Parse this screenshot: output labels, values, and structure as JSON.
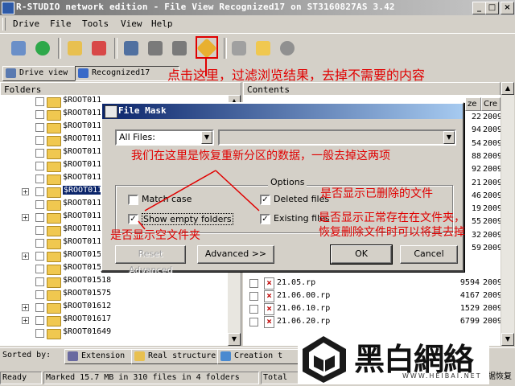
{
  "window": {
    "title": "R-STUDIO network edition - File View Recognized17 on ST3160827AS 3.42"
  },
  "menu": [
    "Drive",
    "File",
    "Tools",
    "View",
    "Help"
  ],
  "toolbar": {
    "icons": [
      "drive-properties-icon",
      "refresh-icon",
      "open-image-icon",
      "create-image-icon",
      "find-icon",
      "find-next-icon",
      "find-prev-icon",
      "file-mask-icon",
      "stop-icon",
      "go-up-icon",
      "preview-icon"
    ]
  },
  "tabs": [
    {
      "label": "Drive view"
    },
    {
      "label": "Recognized17"
    }
  ],
  "annotations": {
    "top": "点击这里，过滤浏览结果，去掉不需要的内容",
    "partition": "我们在这里是恢复重新分区的数据，一般去掉这两项",
    "deleted": "是否显示已删除的文件",
    "existing": "是否显示正常存在在文件夹，恢复删除文件时可以将其去掉",
    "empty": "是否显示空文件夹"
  },
  "folders": {
    "header": "Folders",
    "items": [
      {
        "name": "$ROOT011",
        "plus": false
      },
      {
        "name": "$ROOT011",
        "plus": false
      },
      {
        "name": "$ROOT011",
        "plus": false
      },
      {
        "name": "$ROOT011",
        "plus": false
      },
      {
        "name": "$ROOT011",
        "plus": false
      },
      {
        "name": "$ROOT011",
        "plus": false
      },
      {
        "name": "$ROOT011",
        "plus": false
      },
      {
        "name": "$ROOT011",
        "plus": true,
        "selected": true
      },
      {
        "name": "$ROOT011",
        "plus": false
      },
      {
        "name": "$ROOT011",
        "plus": true
      },
      {
        "name": "$ROOT011",
        "plus": false
      },
      {
        "name": "$ROOT011",
        "plus": false
      },
      {
        "name": "$ROOT015",
        "plus": true
      },
      {
        "name": "$ROOT01514",
        "plus": false
      },
      {
        "name": "$ROOT01518",
        "plus": false
      },
      {
        "name": "$ROOT01575",
        "plus": false
      },
      {
        "name": "$ROOT01612",
        "plus": true
      },
      {
        "name": "$ROOT01617",
        "plus": true
      },
      {
        "name": "$ROOT01649",
        "plus": false
      }
    ]
  },
  "contents": {
    "header": "Contents",
    "columns": [
      "ze",
      "Cre"
    ],
    "partial_rows": [
      {
        "size": "22",
        "date": "2009"
      },
      {
        "size": "94",
        "date": "2009"
      },
      {
        "size": "54",
        "date": "2009"
      },
      {
        "size": "88",
        "date": "2009"
      },
      {
        "size": "92",
        "date": "2009"
      },
      {
        "size": "21",
        "date": "2009"
      },
      {
        "size": "46",
        "date": "2009"
      },
      {
        "size": "19",
        "date": "2009"
      },
      {
        "size": "55",
        "date": "2009"
      },
      {
        "size": "32",
        "date": "2009"
      },
      {
        "size": "59",
        "date": "2009"
      }
    ],
    "rows": [
      {
        "name": "21.05.rp",
        "size": "9594",
        "date": "2009"
      },
      {
        "name": "21.06.00.rp",
        "size": "4167",
        "date": "2009"
      },
      {
        "name": "21.06.10.rp",
        "size": "1529",
        "date": "2009"
      },
      {
        "name": "21.06.20.rp",
        "size": "6799",
        "date": "2009"
      }
    ]
  },
  "dialog": {
    "title": "File Mask",
    "files_combo": "All Files:",
    "mask_input": "",
    "options_label": "Options",
    "match_case": {
      "label": "Match case",
      "checked": false
    },
    "show_empty": {
      "label": "Show empty folders",
      "checked": true
    },
    "deleted": {
      "label": "Deleted files",
      "checked": true
    },
    "existing": {
      "label": "Existing files",
      "checked": true
    },
    "buttons": {
      "reset": "Reset Advanced",
      "advanced": "Advanced >>",
      "ok": "OK",
      "cancel": "Cancel"
    }
  },
  "sortbar": {
    "label": "Sorted by:",
    "extension": "Extension",
    "real": "Real structure",
    "creation": "Creation t"
  },
  "status": {
    "ready": "Ready",
    "marked": "Marked 15.7 MB in 310 files in 4 folders",
    "total": "Total",
    "tail": "据恢复"
  },
  "watermark": {
    "text": "黑白網絡",
    "url": "WWW.HEIBAI.NET"
  }
}
